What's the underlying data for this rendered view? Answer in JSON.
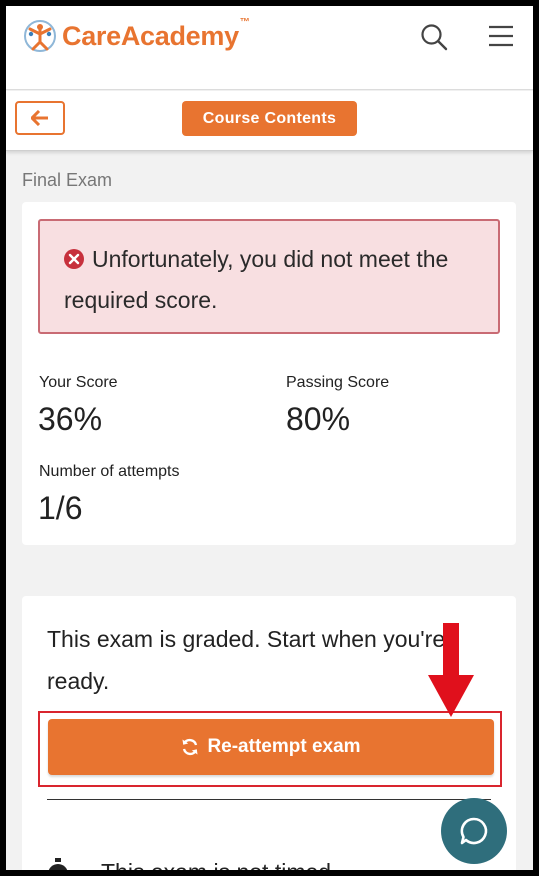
{
  "header": {
    "brand": "CareAcademy",
    "trademark": "™"
  },
  "toolbar": {
    "back_icon": "arrow-left-icon",
    "course_contents_label": "Course Contents"
  },
  "section": {
    "title": "Final Exam"
  },
  "result": {
    "alert_icon": "error-circle-icon",
    "alert_message": "Unfortunately, you did not meet the required score.",
    "your_score_label": "Your Score",
    "your_score_value": "36%",
    "passing_score_label": "Passing Score",
    "passing_score_value": "80%",
    "attempts_label": "Number of attempts",
    "attempts_value": "1/6"
  },
  "exam": {
    "intro_text": "This exam is graded. Start when you're ready.",
    "reattempt_label": "Re-attempt exam",
    "timed_text": "This exam is not timed"
  },
  "colors": {
    "brand_orange": "#e87430",
    "alert_bg": "#f8dfe1",
    "alert_border": "#c96b74",
    "annotation_red": "#d9252e",
    "chat_teal": "#2f6e7c"
  }
}
